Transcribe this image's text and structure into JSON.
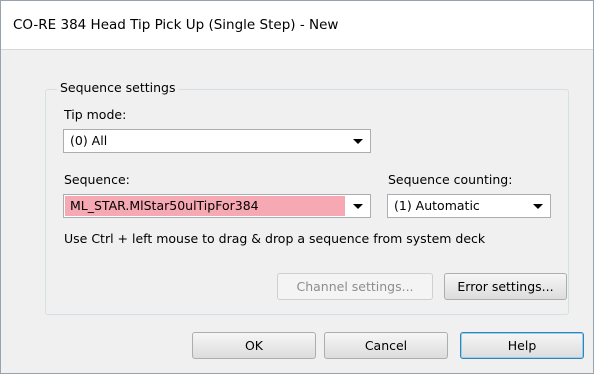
{
  "window": {
    "title": "CO-RE 384 Head Tip Pick Up (Single Step) - New"
  },
  "sequence_settings": {
    "group_title": "Sequence settings",
    "tip_mode": {
      "label": "Tip mode:",
      "value": "(0) All"
    },
    "sequence": {
      "label": "Sequence:",
      "value": "ML_STAR.MlStar50ulTipFor384",
      "highlight_color": "#f6a9b3"
    },
    "sequence_counting": {
      "label": "Sequence counting:",
      "value": "(1) Automatic"
    },
    "hint": "Use Ctrl + left mouse to drag & drop a sequence from system deck"
  },
  "buttons": {
    "channel_settings": "Channel settings...",
    "error_settings": "Error settings...",
    "ok": "OK",
    "cancel": "Cancel",
    "help": "Help"
  }
}
